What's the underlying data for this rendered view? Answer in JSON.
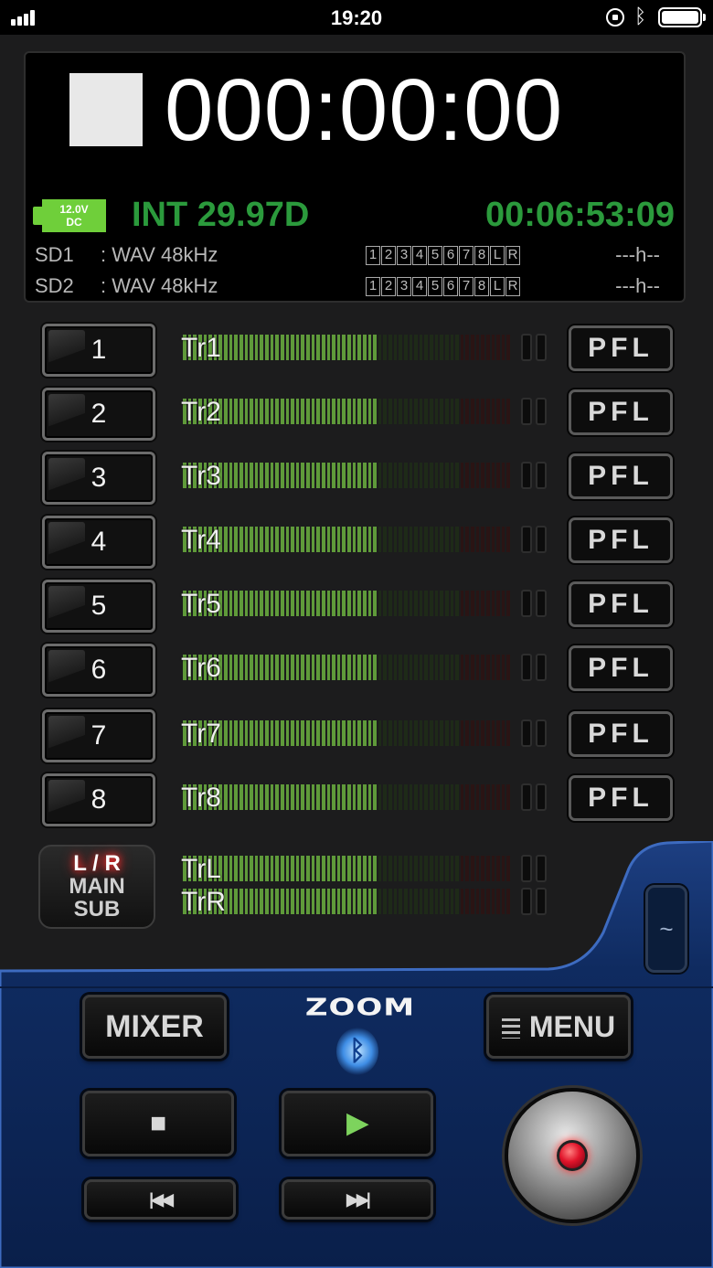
{
  "status_bar": {
    "time": "19:20",
    "bluetooth_icon": "bluetooth-icon",
    "battery_icon": "battery-icon"
  },
  "display": {
    "timecode": "000:00:00",
    "power": "12.0V\nDC",
    "power_line1": "12.0V",
    "power_line2": "DC",
    "fps": "INT 29.97D",
    "elapsed": "00:06:53:09",
    "cards": [
      {
        "label": "SD1",
        "format": ": WAV 48kHz",
        "tracks": [
          "1",
          "2",
          "3",
          "4",
          "5",
          "6",
          "7",
          "8",
          "L",
          "R"
        ],
        "remaining": "---h--"
      },
      {
        "label": "SD2",
        "format": ": WAV 48kHz",
        "tracks": [
          "1",
          "2",
          "3",
          "4",
          "5",
          "6",
          "7",
          "8",
          "L",
          "R"
        ],
        "remaining": "---h--"
      }
    ]
  },
  "tracks": [
    {
      "button": "1",
      "name": "Tr1",
      "pfl": "PFL"
    },
    {
      "button": "2",
      "name": "Tr2",
      "pfl": "PFL"
    },
    {
      "button": "3",
      "name": "Tr3",
      "pfl": "PFL"
    },
    {
      "button": "4",
      "name": "Tr4",
      "pfl": "PFL"
    },
    {
      "button": "5",
      "name": "Tr5",
      "pfl": "PFL"
    },
    {
      "button": "6",
      "name": "Tr6",
      "pfl": "PFL"
    },
    {
      "button": "7",
      "name": "Tr7",
      "pfl": "PFL"
    },
    {
      "button": "8",
      "name": "Tr8",
      "pfl": "PFL"
    }
  ],
  "main_bus": {
    "label_top": "L / R",
    "label_mid": "MAIN",
    "label_bottom": "SUB",
    "left": "TrL",
    "right": "TrR"
  },
  "controls": {
    "mixer": "MIXER",
    "menu": "MENU",
    "brand": "ZOOM",
    "stop": "■",
    "play": "▶",
    "prev": "|◀◀",
    "next": "▶▶|",
    "scroll": "~"
  },
  "colors": {
    "meter_green": "#5f9a3a",
    "meter_dark": "#1e2a18",
    "meter_red_dark": "#2a1414",
    "display_green": "#2b9a3c",
    "panel_blue": "#10306a"
  }
}
